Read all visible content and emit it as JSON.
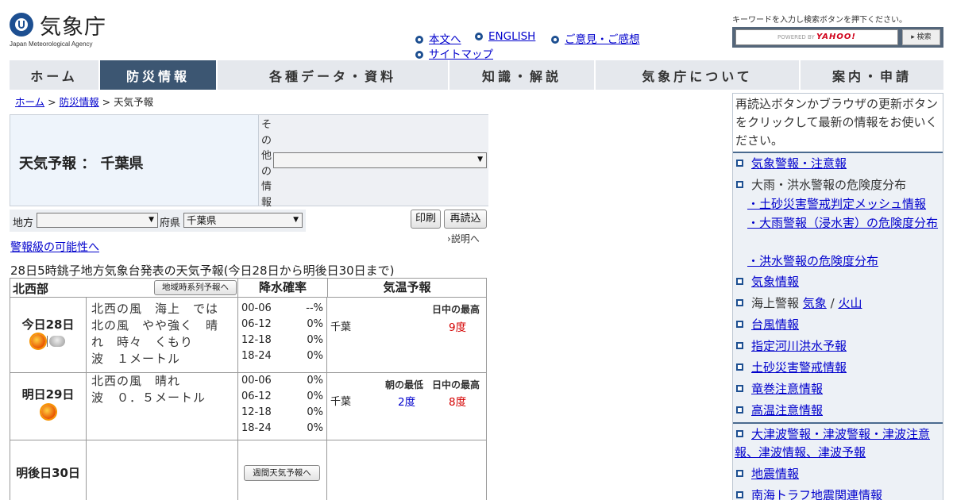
{
  "header": {
    "logo_name": "気象庁",
    "logo_sub": "Japan Meteorological Agency",
    "links": [
      "本文へ",
      "ENGLISH",
      "ご意見・ご感想",
      "サイトマップ"
    ],
    "search_hint": "キーワードを入力し検索ボタンを押下ください。",
    "search_powered": "POWERED BY",
    "search_brand": "YAHOO!",
    "search_button": "▸ 検索"
  },
  "nav": [
    "ホーム",
    "防災情報",
    "各種データ・資料",
    "知識・解説",
    "気象庁について",
    "案内・申請"
  ],
  "breadcrumb": {
    "home": "ホーム",
    "sep1": ">",
    "bousai": "防災情報",
    "sep2": ">",
    "current": "天気予報"
  },
  "title": "天気予報 ： 千葉県",
  "other_info_label": "その他の情報",
  "other_info_value": "",
  "area": {
    "region_label": "地方",
    "region_value": "",
    "pref_label": "府県",
    "pref_value": "千葉県"
  },
  "buttons": {
    "print": "印刷",
    "reload": "再読込"
  },
  "explain": "説明へ",
  "warn_link": "警報級の可能性へ",
  "issued": "28日5時銚子地方気象台発表の天気予報(今日28日から明後日30日まで)",
  "table": {
    "region": "北西部",
    "series_button": "地域時系列予報へ",
    "precip_header": "降水確率",
    "temp_header": "気温予報",
    "weekly_button": "週間天気予報へ",
    "days": [
      {
        "label": "今日28日",
        "icons": [
          "sun-icon",
          "cloud-icon"
        ],
        "text": "北西の風　海上　では　北の風　やや強く　晴れ　時々　くもり　波　１メートル",
        "lines": [
          "北西の風　海上　では",
          "北の風　やや強く　晴",
          "れ　時々　くもり",
          "波　１メートル"
        ],
        "precip": [
          [
            "00-06",
            "--%"
          ],
          [
            "06-12",
            "0%"
          ],
          [
            "12-18",
            "0%"
          ],
          [
            "18-24",
            "0%"
          ]
        ],
        "temp_caption_max": "日中の最高",
        "temp_caption_min": "",
        "city": "千葉",
        "min": "",
        "max": "9度"
      },
      {
        "label": "明日29日",
        "icons": [
          "sun-icon"
        ],
        "lines": [
          "北西の風　晴れ",
          "波　０．５メートル"
        ],
        "precip": [
          [
            "00-06",
            "0%"
          ],
          [
            "06-12",
            "0%"
          ],
          [
            "12-18",
            "0%"
          ],
          [
            "18-24",
            "0%"
          ]
        ],
        "temp_caption_max": "日中の最高",
        "temp_caption_min": "朝の最低",
        "city": "千葉",
        "min": "2度",
        "max": "8度"
      },
      {
        "label": "明後日30日"
      }
    ]
  },
  "sidebar": {
    "notice": "再読込ボタンかブラウザの更新ボタンをクリックして最新の情報をお使いください。",
    "items": {
      "keiho": "気象警報・注意報",
      "kikendo": "大雨・洪水警報の危険度分布",
      "dosha_mesh": "・土砂災害警戒判定メッシュ情報",
      "oame": "・大雨警報（浸水害）の危険度分布",
      "kouzui": "・洪水警報の危険度分布",
      "kishou_joho": "気象情報",
      "kaijo_prefix": "海上警報",
      "kaijo_kishou": "気象",
      "kaijo_slash": "/",
      "kaijo_kazan": "火山",
      "taifu": "台風情報",
      "kasen": "指定河川洪水予報",
      "dosha_keikai": "土砂災害警戒情報",
      "tatsumaki": "竜巻注意情報",
      "kouon": "高温注意情報",
      "tsunami": "大津波警報・津波警報・津波注意報、津波情報、津波予報",
      "jishin": "地震情報",
      "nankai": "南海トラフ地震関連情報"
    }
  }
}
